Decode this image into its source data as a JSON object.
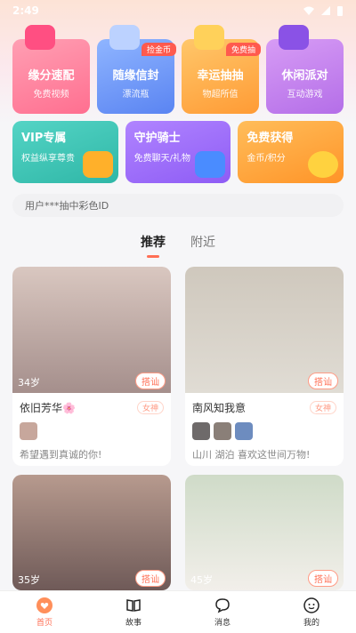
{
  "status": {
    "time": "2:49"
  },
  "features": [
    {
      "title": "缘分速配",
      "subtitle": "免费视频",
      "badge": ""
    },
    {
      "title": "随缘信封",
      "subtitle": "漂流瓶",
      "badge": "捡金币"
    },
    {
      "title": "幸运抽抽",
      "subtitle": "物超所值",
      "badge": "免费抽"
    },
    {
      "title": "休闲派对",
      "subtitle": "互动游戏",
      "badge": ""
    }
  ],
  "banners": [
    {
      "title": "VIP专属",
      "subtitle": "权益纵享尊贵"
    },
    {
      "title": "守护骑士",
      "subtitle": "免费聊天/礼物"
    },
    {
      "title": "免费获得",
      "subtitle": "金币/积分"
    }
  ],
  "notice": "用户***抽中彩色ID",
  "tabs": [
    "推荐",
    "附近"
  ],
  "feed": [
    {
      "age": "34岁",
      "greet": "搭讪",
      "name": "依旧芳华🌸",
      "tag": "女神",
      "bio": "希望遇到真诚的你!"
    },
    {
      "age": "",
      "greet": "搭讪",
      "name": "南风知我意",
      "tag": "女神",
      "bio": "山川 湖泊 喜欢这世间万物!"
    },
    {
      "age": "35岁",
      "greet": "搭讪"
    },
    {
      "age": "45岁",
      "greet": "搭讪"
    }
  ],
  "nav": [
    {
      "label": "首页",
      "icon": "home-icon"
    },
    {
      "label": "故事",
      "icon": "book-icon"
    },
    {
      "label": "消息",
      "icon": "chat-icon"
    },
    {
      "label": "我的",
      "icon": "profile-icon"
    }
  ]
}
